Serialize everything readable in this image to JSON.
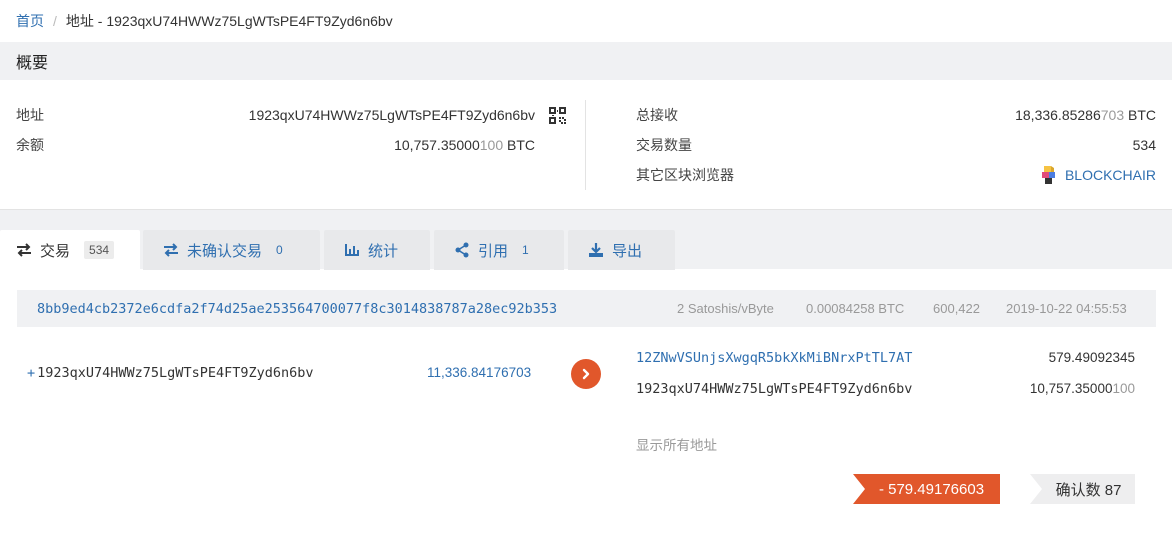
{
  "breadcrumb": {
    "home": "首页",
    "separator": "/",
    "current": "地址 - 1923qxU74HWWz75LgWTsPE4FT9Zyd6n6bv"
  },
  "overview": {
    "title": "概要",
    "left": {
      "address_label": "地址",
      "address_value": "1923qxU74HWWz75LgWTsPE4FT9Zyd6n6bv",
      "balance_label": "余额",
      "balance_main": "10,757.35000",
      "balance_fade": "100",
      "balance_unit": " BTC"
    },
    "right": {
      "received_label": "总接收",
      "received_main": "18,336.85286",
      "received_fade": "703",
      "received_unit": " BTC",
      "tx_count_label": "交易数量",
      "tx_count_value": "534",
      "explorers_label": "其它区块浏览器",
      "explorer_name": "BLOCKCHAIR"
    }
  },
  "tabs": [
    {
      "label": "交易",
      "count": "534",
      "icon": "transfer-icon"
    },
    {
      "label": "未确认交易",
      "count": "0",
      "icon": "transfer-icon"
    },
    {
      "label": "统计",
      "count": "",
      "icon": "bar-chart-icon"
    },
    {
      "label": "引用",
      "count": "1",
      "icon": "share-icon"
    },
    {
      "label": "导出",
      "count": "",
      "icon": "download-icon"
    }
  ],
  "transaction": {
    "hash": "8bb9ed4cb2372e6cdfa2f74d25ae253564700077f8c3014838787a28ec92b353",
    "fee_rate": "2 Satoshis/vByte",
    "fee": "0.00084258 BTC",
    "block": "600,422",
    "time": "2019-10-22 04:55:53",
    "input": {
      "sign": "+",
      "address": "1923qxU74HWWz75LgWTsPE4FT9Zyd6n6bv",
      "amount": "11,336.84176703"
    },
    "outputs": [
      {
        "address": "12ZNwVSUnjsXwgqR5bkXkMiBNrxPtTL7AT",
        "amount_main": "579.49092345",
        "amount_fade": ""
      },
      {
        "address": "1923qxU74HWWz75LgWTsPE4FT9Zyd6n6bv",
        "amount_main": "10,757.35000",
        "amount_fade": "100"
      }
    ],
    "show_all": "显示所有地址",
    "delta": "- 579.49176603",
    "confirmations": "确认数 87"
  },
  "colors": {
    "link": "#2f6fb0",
    "accent": "#e1572b",
    "panel": "#f0f1f3"
  }
}
